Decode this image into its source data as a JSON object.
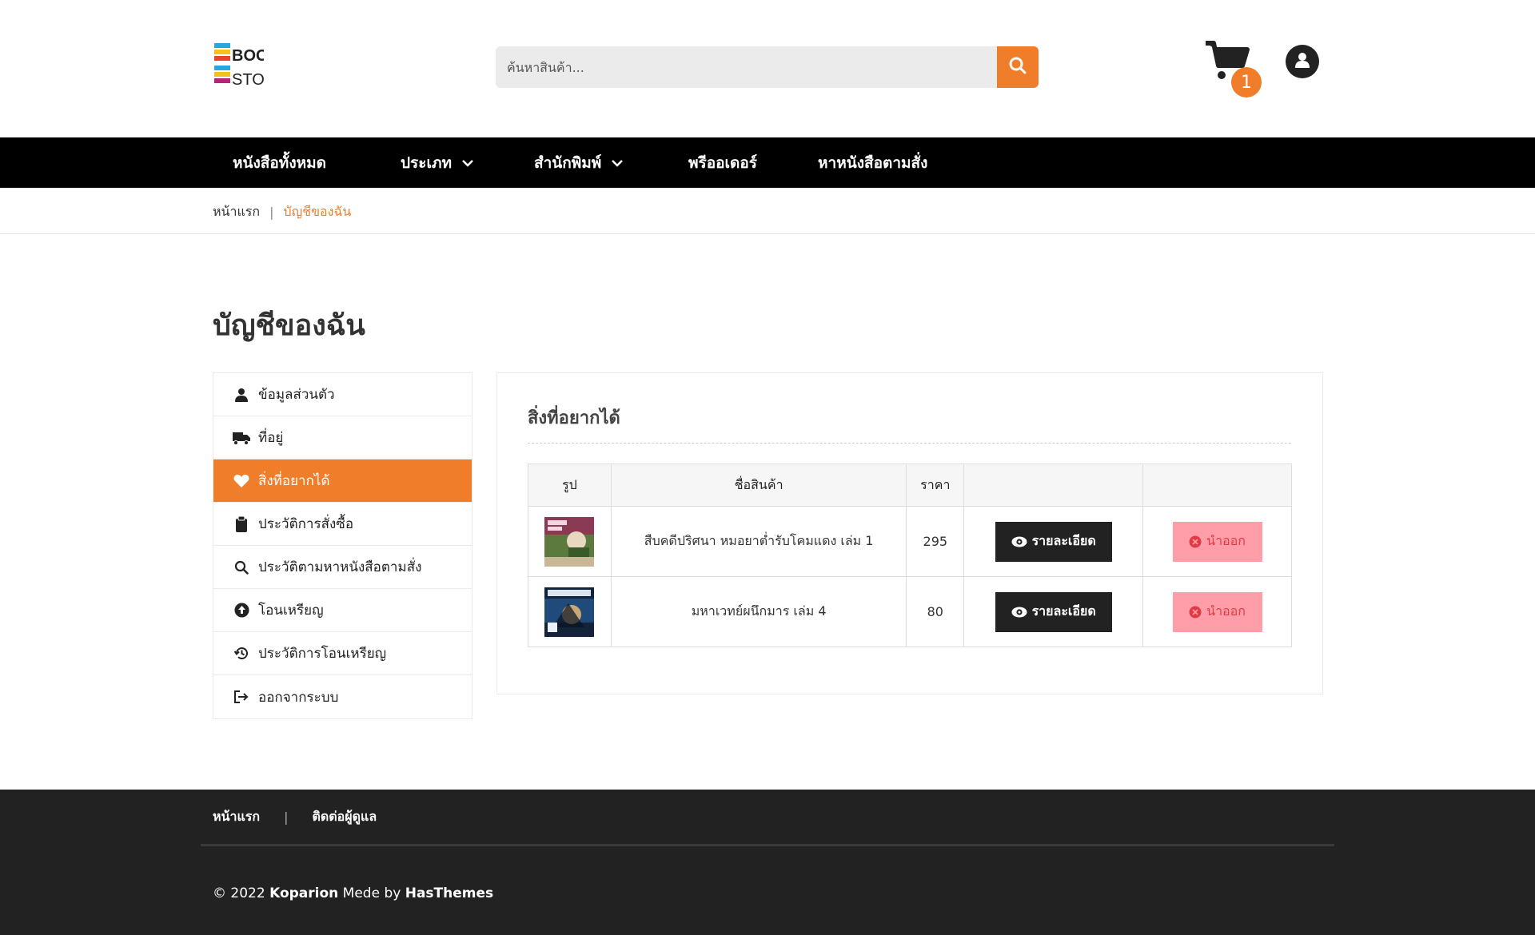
{
  "header": {
    "logo_text_top": "BOOK",
    "logo_text_bottom": "STORE",
    "search_placeholder": "ค้นหาสินค้า...",
    "cart_count": "1"
  },
  "nav": {
    "items": [
      {
        "label": "หนังสือทั้งหมด"
      },
      {
        "label": "ประเภท"
      },
      {
        "label": "สำนักพิมพ์"
      },
      {
        "label": "พรีออเดอร์"
      },
      {
        "label": "หาหนังสือตามสั่ง"
      }
    ]
  },
  "breadcrumb": {
    "home": "หน้าแรก",
    "separator": "|",
    "current": "บัญชีของฉัน"
  },
  "page_title": "บัญชีของฉัน",
  "sidebar": {
    "items": [
      {
        "label": "ข้อมูลส่วนตัว",
        "icon": "user-icon"
      },
      {
        "label": "ที่อยู่",
        "icon": "truck-icon"
      },
      {
        "label": "สิ่งที่อยากได้",
        "icon": "heart-icon",
        "active": true
      },
      {
        "label": "ประวัติการสั่งซื้อ",
        "icon": "clipboard-icon"
      },
      {
        "label": "ประวัติตามหาหนังสือตามสั่ง",
        "icon": "search-icon"
      },
      {
        "label": "โอนเหรียญ",
        "icon": "upload-circle-icon"
      },
      {
        "label": "ประวัติการโอนเหรียญ",
        "icon": "history-icon"
      },
      {
        "label": "ออกจากระบบ",
        "icon": "sign-out-icon"
      }
    ]
  },
  "wishlist": {
    "title": "สิ่งที่อยากได้",
    "columns": [
      "รูป",
      "ชื่อสินค้า",
      "ราคา",
      "",
      ""
    ],
    "rows": [
      {
        "name": "สืบคดีปริศนา หมอยาต่ำรับโคมแดง เล่ม 1",
        "price": "295",
        "detail_label": "รายละเอียด",
        "remove_label": "นำออก"
      },
      {
        "name": "มหาเวทย์ผนึกมาร เล่ม 4",
        "price": "80",
        "detail_label": "รายละเอียด",
        "remove_label": "นำออก"
      }
    ]
  },
  "footer": {
    "links": [
      "หน้าแรก",
      "ติดต่อผู้ดูแล"
    ],
    "separator": "|",
    "copyright_prefix": "© 2022 ",
    "copyright_brand": "Koparion",
    "copyright_middle": " Mede by ",
    "copyright_author": "HasThemes"
  },
  "colors": {
    "accent": "#f07d2a",
    "nav_bg": "#000000",
    "footer_bg": "#222222",
    "remove_bg": "#ff9ea8",
    "remove_text": "#e23a45"
  }
}
